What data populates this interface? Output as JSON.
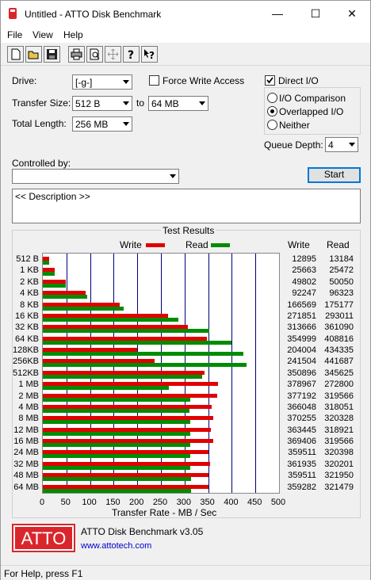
{
  "window": {
    "title": "Untitled - ATTO Disk Benchmark"
  },
  "titlebar_buttons": {
    "minimize": "—",
    "maximize": "☐",
    "close": "✕"
  },
  "menu": [
    "File",
    "View",
    "Help"
  ],
  "toolbar_icons": [
    "new-icon",
    "open-icon",
    "save-icon",
    "print-icon",
    "print-preview-icon",
    "move-icon",
    "help-icon",
    "context-help-icon"
  ],
  "form": {
    "drive_label": "Drive:",
    "drive_value": "[-g-]",
    "transfer_size_label": "Transfer Size:",
    "transfer_from": "512 B",
    "to_label": "to",
    "transfer_to": "64 MB",
    "total_length_label": "Total Length:",
    "total_length": "256 MB",
    "force_write_access": "Force Write Access",
    "force_write_checked": false,
    "direct_io": "Direct I/O",
    "direct_io_checked": true,
    "io_comparison": "I/O Comparison",
    "overlapped_io": "Overlapped I/O",
    "neither": "Neither",
    "selected_io": "Overlapped I/O",
    "queue_depth_label": "Queue Depth:",
    "queue_depth": "4",
    "controlled_by_label": "Controlled by:",
    "controlled_by_value": "",
    "start_label": "Start",
    "description": "<< Description >>"
  },
  "results": {
    "group_title": "Test Results",
    "write_legend": "Write",
    "read_legend": "Read",
    "write_col": "Write",
    "read_col": "Read",
    "xlabel": "Transfer Rate - MB / Sec"
  },
  "chart_data": {
    "type": "bar",
    "orientation": "horizontal",
    "xlim": [
      0,
      500
    ],
    "xticks": [
      "0",
      "50",
      "100",
      "150",
      "200",
      "250",
      "300",
      "350",
      "400",
      "450",
      "500"
    ],
    "xlabel": "Transfer Rate - MB / Sec",
    "categories": [
      "512 B",
      "1 KB",
      "2 KB",
      "4 KB",
      "8 KB",
      "16 KB",
      "32 KB",
      "64 KB",
      "128KB",
      "256KB",
      "512KB",
      "1 MB",
      "2 MB",
      "4 MB",
      "8 MB",
      "12 MB",
      "16 MB",
      "24 MB",
      "32 MB",
      "48 MB",
      "64 MB"
    ],
    "series": [
      {
        "name": "Write",
        "color": "#e00000",
        "values": [
          12895,
          25663,
          49802,
          92247,
          166569,
          271851,
          313666,
          354999,
          204004,
          241504,
          350896,
          378967,
          377192,
          366048,
          370255,
          363445,
          369406,
          359511,
          361935,
          359511,
          359282
        ]
      },
      {
        "name": "Read",
        "color": "#008c00",
        "values": [
          13184,
          25472,
          50050,
          96323,
          175177,
          293011,
          361090,
          408816,
          434335,
          441687,
          345625,
          272800,
          319566,
          318051,
          320328,
          318921,
          319566,
          320398,
          320201,
          321950,
          321479
        ]
      }
    ]
  },
  "branding": {
    "logo": "ATTO",
    "product": "ATTO Disk Benchmark v3.05",
    "url": "www.attotech.com",
    "logo_color": "#d9262c"
  },
  "status": "For Help, press F1"
}
